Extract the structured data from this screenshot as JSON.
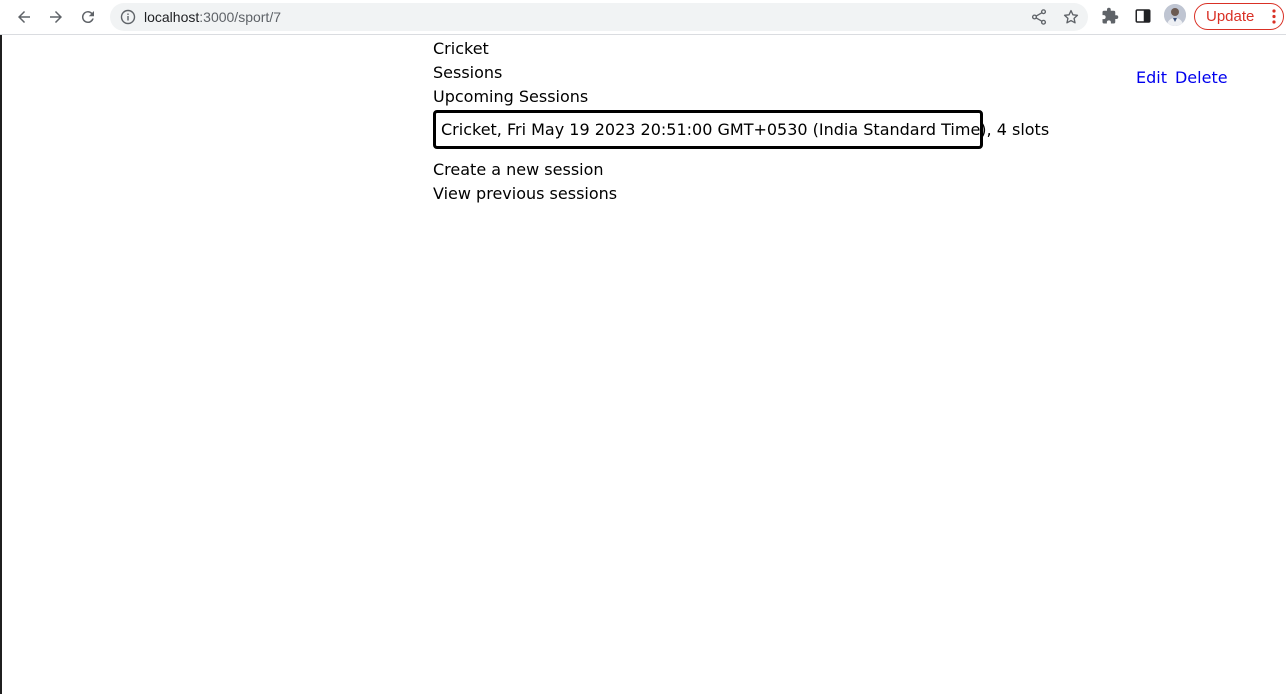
{
  "browser": {
    "url_host": "localhost",
    "url_path": ":3000/sport/7",
    "update_label": "Update"
  },
  "page": {
    "sport_name": "Cricket",
    "sessions_heading": "Sessions",
    "upcoming_heading": "Upcoming Sessions",
    "upcoming_sessions": [
      "Cricket, Fri May 19 2023 20:51:00 GMT+0530 (India Standard Time), 4 slots"
    ],
    "create_link": "Create a new session",
    "previous_link": "View previous sessions",
    "edit_label": "Edit",
    "delete_label": "Delete"
  },
  "icons": [
    "back-arrow-icon",
    "forward-arrow-icon",
    "reload-icon",
    "info-icon",
    "share-icon",
    "star-icon",
    "puzzle-icon",
    "side-panel-icon",
    "kebab-menu-icon"
  ],
  "colors": {
    "link": "#0000ee",
    "update": "#d93025",
    "omnibox": "#f1f3f4"
  }
}
